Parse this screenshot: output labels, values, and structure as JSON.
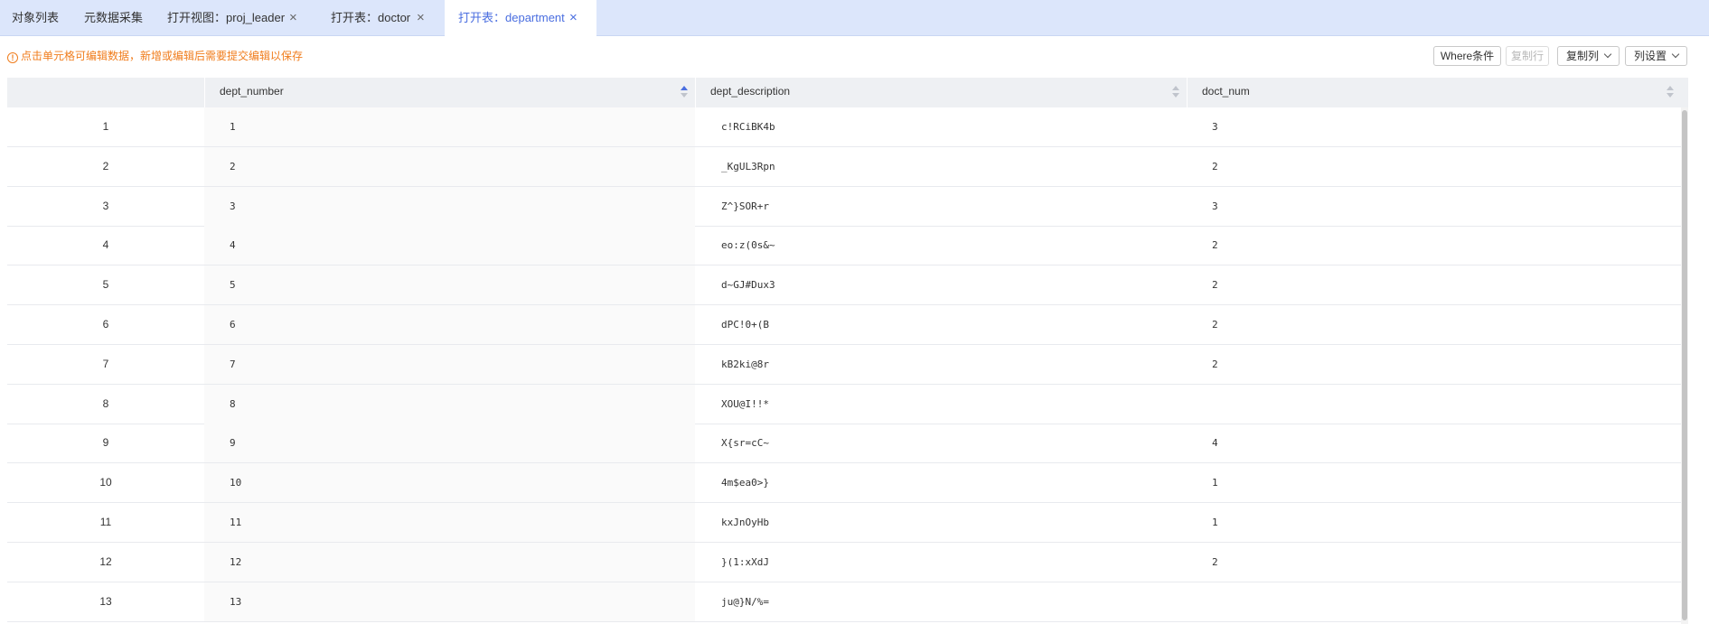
{
  "tabs": [
    {
      "label": "对象列表",
      "closable": false
    },
    {
      "label": "元数据采集",
      "closable": false
    },
    {
      "label": "打开视图：proj_leader",
      "closable": true
    },
    {
      "label": "打开表：doctor",
      "closable": true
    },
    {
      "label": "打开表：department",
      "closable": true,
      "active": true
    }
  ],
  "close_glyph": "×",
  "notice": {
    "icon_glyph": "!",
    "text": "点击单元格可编辑数据，新增或编辑后需要提交编辑以保存"
  },
  "toolbar": {
    "where": "Where条件",
    "copy_row": "复制行",
    "copy_col": "复制列",
    "col_settings": "列设置"
  },
  "columns": [
    "dept_number",
    "dept_description",
    "doct_num"
  ],
  "rows": [
    {
      "idx": "1",
      "dept_number": "1",
      "dept_description": "c!RCiBK4b",
      "doct_num": "3"
    },
    {
      "idx": "2",
      "dept_number": "2",
      "dept_description": "_KgUL3Rpn",
      "doct_num": "2"
    },
    {
      "idx": "3",
      "dept_number": "3",
      "dept_description": "Z^}SOR+r",
      "doct_num": "3"
    },
    {
      "idx": "4",
      "dept_number": "4",
      "dept_description": "eo:z(0s&~",
      "doct_num": "2"
    },
    {
      "idx": "5",
      "dept_number": "5",
      "dept_description": "d~GJ#Dux3",
      "doct_num": "2"
    },
    {
      "idx": "6",
      "dept_number": "6",
      "dept_description": "dPC!0+(B",
      "doct_num": "2"
    },
    {
      "idx": "7",
      "dept_number": "7",
      "dept_description": "kB2ki@8r",
      "doct_num": "2"
    },
    {
      "idx": "8",
      "dept_number": "8",
      "dept_description": "XOU@I!!*",
      "doct_num": ""
    },
    {
      "idx": "9",
      "dept_number": "9",
      "dept_description": "X{sr=cC~",
      "doct_num": "4"
    },
    {
      "idx": "10",
      "dept_number": "10",
      "dept_description": "4m$ea0>}",
      "doct_num": "1"
    },
    {
      "idx": "11",
      "dept_number": "11",
      "dept_description": "kxJnOyHb",
      "doct_num": "1"
    },
    {
      "idx": "12",
      "dept_number": "12",
      "dept_description": "}(1:xXdJ",
      "doct_num": "2"
    },
    {
      "idx": "13",
      "dept_number": "13",
      "dept_description": "ju@}N/%=",
      "doct_num": ""
    }
  ],
  "colors": {
    "accent": "#4a6ee0",
    "notice": "#f07d1d",
    "tabbar": "#dce6fb",
    "header": "#eef0f3"
  }
}
